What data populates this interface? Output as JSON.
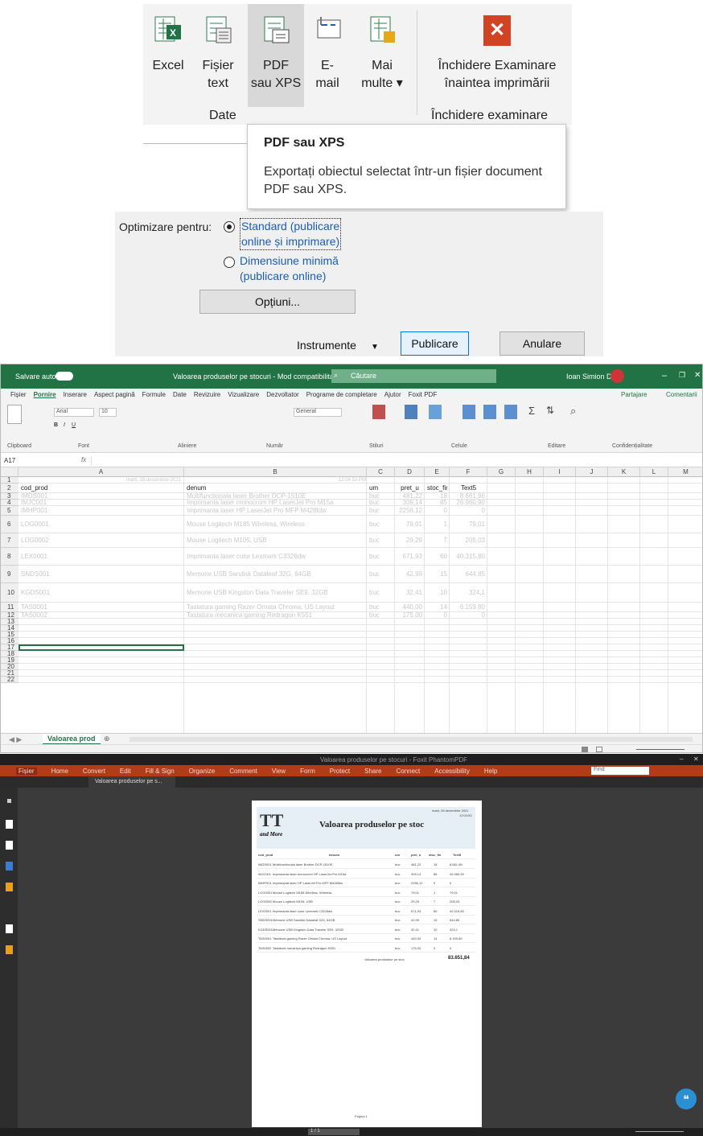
{
  "ribbon": {
    "buttons": [
      {
        "line1": "Excel",
        "line2": ""
      },
      {
        "line1": "Fișier",
        "line2": "text"
      },
      {
        "line1": "PDF",
        "line2": "sau XPS"
      },
      {
        "line1": "E-",
        "line2": "mail"
      },
      {
        "line1": "Mai",
        "line2": "multe ▾"
      },
      {
        "line1": "Închidere Examinare",
        "line2": "înaintea imprimării"
      }
    ],
    "group_date": "Date",
    "group_close": "Închidere examinare"
  },
  "tooltip": {
    "title": "PDF sau XPS",
    "body": "Exportați obiectul selectat într-un fișier document PDF sau XPS."
  },
  "dialog": {
    "optimize_label": "Optimizare pentru:",
    "option_standard_l1": "Standard (publicare",
    "option_standard_l2": "online și imprimare)",
    "option_min_l1": "Dimensiune minimă",
    "option_min_l2": "(publicare online)",
    "options_button": "Opțiuni...",
    "tools_label": "Instrumente",
    "publish_button": "Publicare",
    "cancel_button": "Anulare"
  },
  "excel": {
    "autosave": "Salvare automată",
    "title": "Valoarea produselor pe stocuri - Mod compatibilitate",
    "search": "Căutare",
    "user": "Ioan Simion Dan",
    "menu": [
      "Fișier",
      "Pornire",
      "Inserare",
      "Aspect pagină",
      "Formule",
      "Date",
      "Revizuire",
      "Vizualizare",
      "Dezvoltator",
      "Programe de completare",
      "Ajutor",
      "Foxit PDF"
    ],
    "share": "Partajare",
    "comments": "Comentarii",
    "ribbon_groups": [
      "Clipboard",
      "Font",
      "Aliniere",
      "Număr",
      "Stiluri",
      "Celule",
      "Editare",
      "Confidențialitate"
    ],
    "font_name": "Arial",
    "font_size": "10",
    "number_format": "General",
    "cell_ref": "A17",
    "fx": "fx",
    "columns": [
      "A",
      "B",
      "C",
      "D",
      "E",
      "F",
      "G",
      "H",
      "I",
      "J",
      "K",
      "L",
      "M"
    ],
    "row1": {
      "a": "marți, 28 decembrie 2021",
      "b": "12:04:53 PM"
    },
    "headers": {
      "a": "cod_prod",
      "b": "denum",
      "c": "um",
      "d": "pret_u",
      "e": "stoc_fin",
      "f": "Text5"
    },
    "rows": [
      {
        "n": "3",
        "a": "IMDS001",
        "b": "Multifunctionala laser Brother DCP-1510E",
        "c": "buc",
        "d": "481,22",
        "e": "18",
        "f": "8.661,96"
      },
      {
        "n": "4",
        "a": "IMJC001",
        "b": "Imprimanta laser monocrom HP LaserJet Pro M15a",
        "c": "buc",
        "d": "309,14",
        "e": "85",
        "f": "26.960,90"
      },
      {
        "n": "5",
        "a": "IMHP001",
        "b": "Imprimanta laser HP LaserJet Pro MFP M428fdw",
        "c": "buc",
        "d": "2256,12",
        "e": "0",
        "f": "0"
      },
      {
        "n": "6",
        "a": "LOG0001",
        "b": "Mouse Logitech M185 Wireless, Wireless",
        "c": "buc",
        "d": "79,01",
        "e": "1",
        "f": "79,01"
      },
      {
        "n": "7",
        "a": "LOG0002",
        "b": "Mouse Logitech M105, USB",
        "c": "buc",
        "d": "29,29",
        "e": "7",
        "f": "205,03"
      },
      {
        "n": "8",
        "a": "LEX0001",
        "b": "Imprimanta laser color Lexmark C3326dw",
        "c": "buc",
        "d": "671,93",
        "e": "60",
        "f": "40.315,80"
      },
      {
        "n": "9",
        "a": "SNDS001",
        "b": "Memorie USB Sandisk Dataleaf 32G, 64GB",
        "c": "buc",
        "d": "42,99",
        "e": "15",
        "f": "644,85"
      },
      {
        "n": "10",
        "a": "KGDS001",
        "b": "Memorie USB Kingston Data Traveler SE9, 32GB",
        "c": "buc",
        "d": "32,41",
        "e": "10",
        "f": "324,1"
      },
      {
        "n": "11",
        "a": "TAS0001",
        "b": "Tastatura gaming Razer Ornata Chroma, US Layout",
        "c": "buc",
        "d": "440,00",
        "e": "14",
        "f": "6.159,80"
      },
      {
        "n": "12",
        "a": "TAS0002",
        "b": "Tastatura mecanica gaming Redragon K551",
        "c": "buc",
        "d": "175,00",
        "e": "0",
        "f": "0"
      }
    ],
    "empty_rows": [
      "13",
      "14",
      "15",
      "16",
      "17",
      "18",
      "19",
      "20",
      "21",
      "22"
    ],
    "sheet_tab": "Valoarea prod"
  },
  "foxit": {
    "title": "Valoarea produselor pe stocuri - Foxit PhantomPDF",
    "menu": [
      "Fișier",
      "Home",
      "Convert",
      "Edit",
      "Fill & Sign",
      "Organize",
      "Comment",
      "View",
      "Form",
      "Protect",
      "Share",
      "Connect",
      "Accessibility",
      "Help"
    ],
    "tab": "Valoarea produselor pe s...",
    "find": "Find",
    "doc_title": "Valoarea produselor pe stoc",
    "doc_date": "marți, 28 decembrie 2021",
    "doc_time": "12:04:53",
    "logo_sub": "and More",
    "doc_headers": [
      "cod_prod",
      "denum",
      "um",
      "pret_u",
      "stoc_fin",
      "Text5"
    ],
    "total_label": "Valoarea produselor pe stoc",
    "total_value": "83.651,84",
    "footer": "Pagina 1",
    "page_nav": "1 / 1"
  },
  "colors": {
    "excel_green": "#217346",
    "foxit_red": "#b23b1a",
    "accent_blue": "#1a5fb4"
  }
}
